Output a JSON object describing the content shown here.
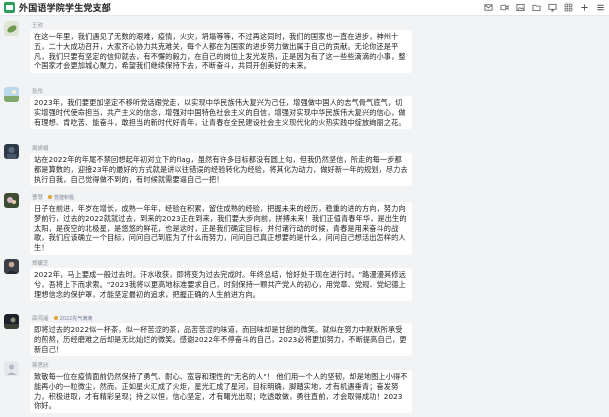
{
  "header": {
    "title": "外国语学院学生党支部",
    "tools": [
      "mail-icon",
      "video-icon",
      "image-icon",
      "folder-icon",
      "screen-icon",
      "grid-icon",
      "plus-icon",
      "more-icon"
    ]
  },
  "colors": {
    "background": "#f2f3f5",
    "bubble": "#ffffff",
    "accent": "#2e9e5e"
  },
  "messages": [
    {
      "name": "王欣",
      "tag": "",
      "avatar": "leaf-avatar",
      "text": "在这一年里，我们遇见了无数的艰难，疫情，火灾，坍塌等等，不过再这同时，我们的国家也一直在进步，神州十五，二十大成功召开，大家齐心协力共克难关，每个人都在为国家的进步努力做出属于自己的贡献。无论你还是平凡，我们只要有坚定的信仰就去，有不懈的毅力，在自己的岗位上发光发热，正是因为有了这一些些滴滴的小事，整个国家才会更加城心聚力，希望我们继续保持下去，不断奋斗，共同开创美好的未来。"
    },
    {
      "name": "张彤",
      "tag": "",
      "avatar": "sky-avatar",
      "text": "2023年，我们要更加坚定不移听党话跟党走，以实现中华民族伟大复兴为己任，增强做中国人的志气骨气底气，切实增强时代使命担当，共产主义的信念，增强对中国特色社会主义的自信，增强对实现中华民族伟大复兴的信心，做有理想、肯吃苦、能奋斗，敢担当的新时代好青年，让青春在全民建设社会主义现代化的火热实践中绽放绚丽之花。"
    },
    {
      "name": "周妍娟",
      "tag": "",
      "avatar": "dark-avatar",
      "text": "站在2022年的年尾不禁回想起年初对立下的flag，虽然有许多目标都没有圆上勾，但我仍然坚信，所走的每一步都都是算数的，迎接23年的最好的方式就是讲以往错误的经验转化为经验，将其化为动力，做好新一年的规划，尽力去执行自我，自己觉得做不到的，有时候就需要逼自己一把！"
    },
    {
      "name": "曹慧",
      "tag": "党建积极",
      "avatar": "bloom-avatar",
      "text": "日子在前进，年岁在增长，成熟一年年，经验在积累，留住成熟的经验，把握未来的经历，稳重的进的方向，努力向梦前行，过去的2022就就过去，到来的2023正在到来，我们要大步向前，拼搏未来！我们正值青春年华，是出生的太阳，是夜空的北极星，是悠悠的鲜花，也是这时，正是我们确定目标，并付诸行动的时候，青春是用来奋斗的战歌，我们应该确立一个目标，问问自己到底为了什么而努力，问问自己真正想要的是什么，问问自己想活出怎样的人生！"
    },
    {
      "name": "郑婕芝",
      "tag": "",
      "avatar": "portrait-avatar",
      "text": "2022年，马上要成一般过去时。汗水收获，即将变为过去完成时。年终总结，恰好处于现在进行时。\"路漫漫其修远兮，吾将上下而求索。\"2023我将以更高地标准要求自己，时刻保持一颗共产党人的初心，用党章、党规、党纪德上理想信念的保护罩，才能坚定最初的追求，把握正确的人生前进方向。"
    },
    {
      "name": "邵鸿遥",
      "tag": "2022先气满满",
      "avatar": "night-avatar",
      "text": "即将过去的2022似一杯茶，似一杯苦涩的茶，品苦苦涩的味道，而回味却是甘甜的微笑。就似在努力中默默所承受的煎熬，历经磨难之后却是无比灿烂的微笑。感谢2022年不停奋斗的自己，2023必将更加努力，不断提高自己，更新自己！"
    },
    {
      "name": "蒋思欣",
      "tag": "",
      "avatar": "plain-avatar",
      "text": "致敬每一位在疫情面前仍然保持了勇气、耐心、宽容和理性的\"无名的人\"！ 他们用一个人的坚韧，却是地图上小得不能再小的一粒微尘，然而，正如星火汇成了火炬，星光汇成了星河，目标明确，脚踏实地，才有机遇垂青；奋发努力，积极进取，才有精彩呈现；持之以恒，信心坚定，才有曙光出现；吃透敢做，勇往直前，才会取得成功！2023你好。"
    }
  ]
}
